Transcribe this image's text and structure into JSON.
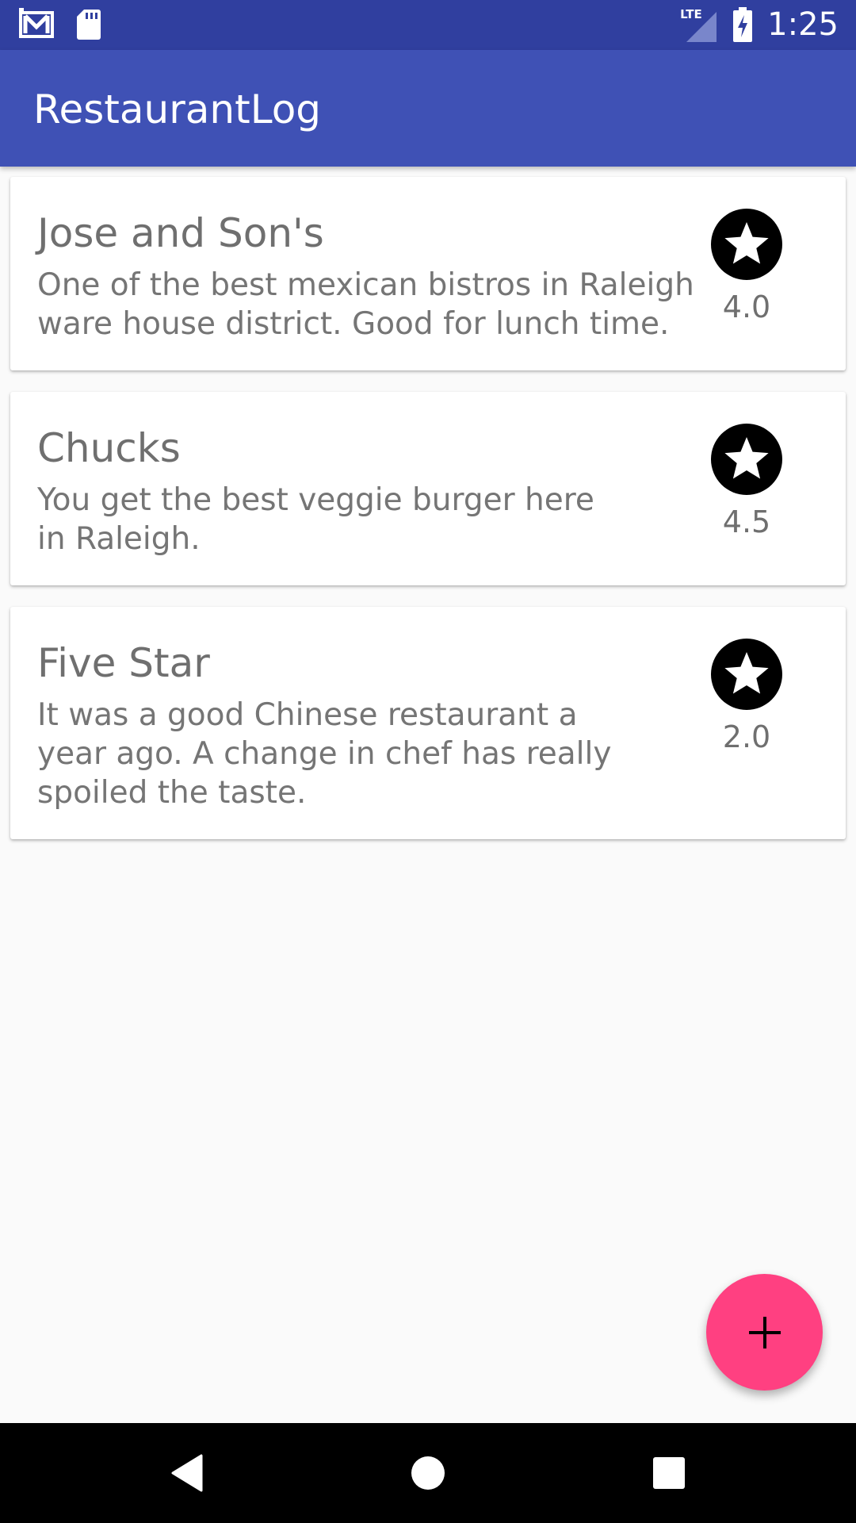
{
  "status_bar": {
    "time": "1:25",
    "network": "LTE",
    "icons": [
      "gmail-icon",
      "sd-card-icon",
      "lte-signal-icon",
      "battery-charging-icon"
    ]
  },
  "app_bar": {
    "title": "RestaurantLog"
  },
  "restaurants": [
    {
      "name": "Jose and Son's",
      "description_lines": [
        "One of the best mexican bistros in Raleigh",
        "ware house district. Good for lunch time."
      ],
      "rating": "4.0"
    },
    {
      "name": "Chucks",
      "description_lines": [
        "You get the best veggie burger here",
        "in Raleigh."
      ],
      "rating": "4.5"
    },
    {
      "name": "Five Star",
      "description_lines": [
        "It was a good Chinese restaurant a",
        "year ago. A change in chef has really",
        "spoiled the taste."
      ],
      "rating": "2.0"
    }
  ],
  "fab": {
    "icon": "plus-icon"
  },
  "nav_bar": {
    "icons": [
      "back-icon",
      "home-icon",
      "recents-icon"
    ]
  },
  "colors": {
    "primary": "#3f51b5",
    "primary_dark": "#303f9f",
    "accent": "#ff4081",
    "background": "#fafafa"
  }
}
